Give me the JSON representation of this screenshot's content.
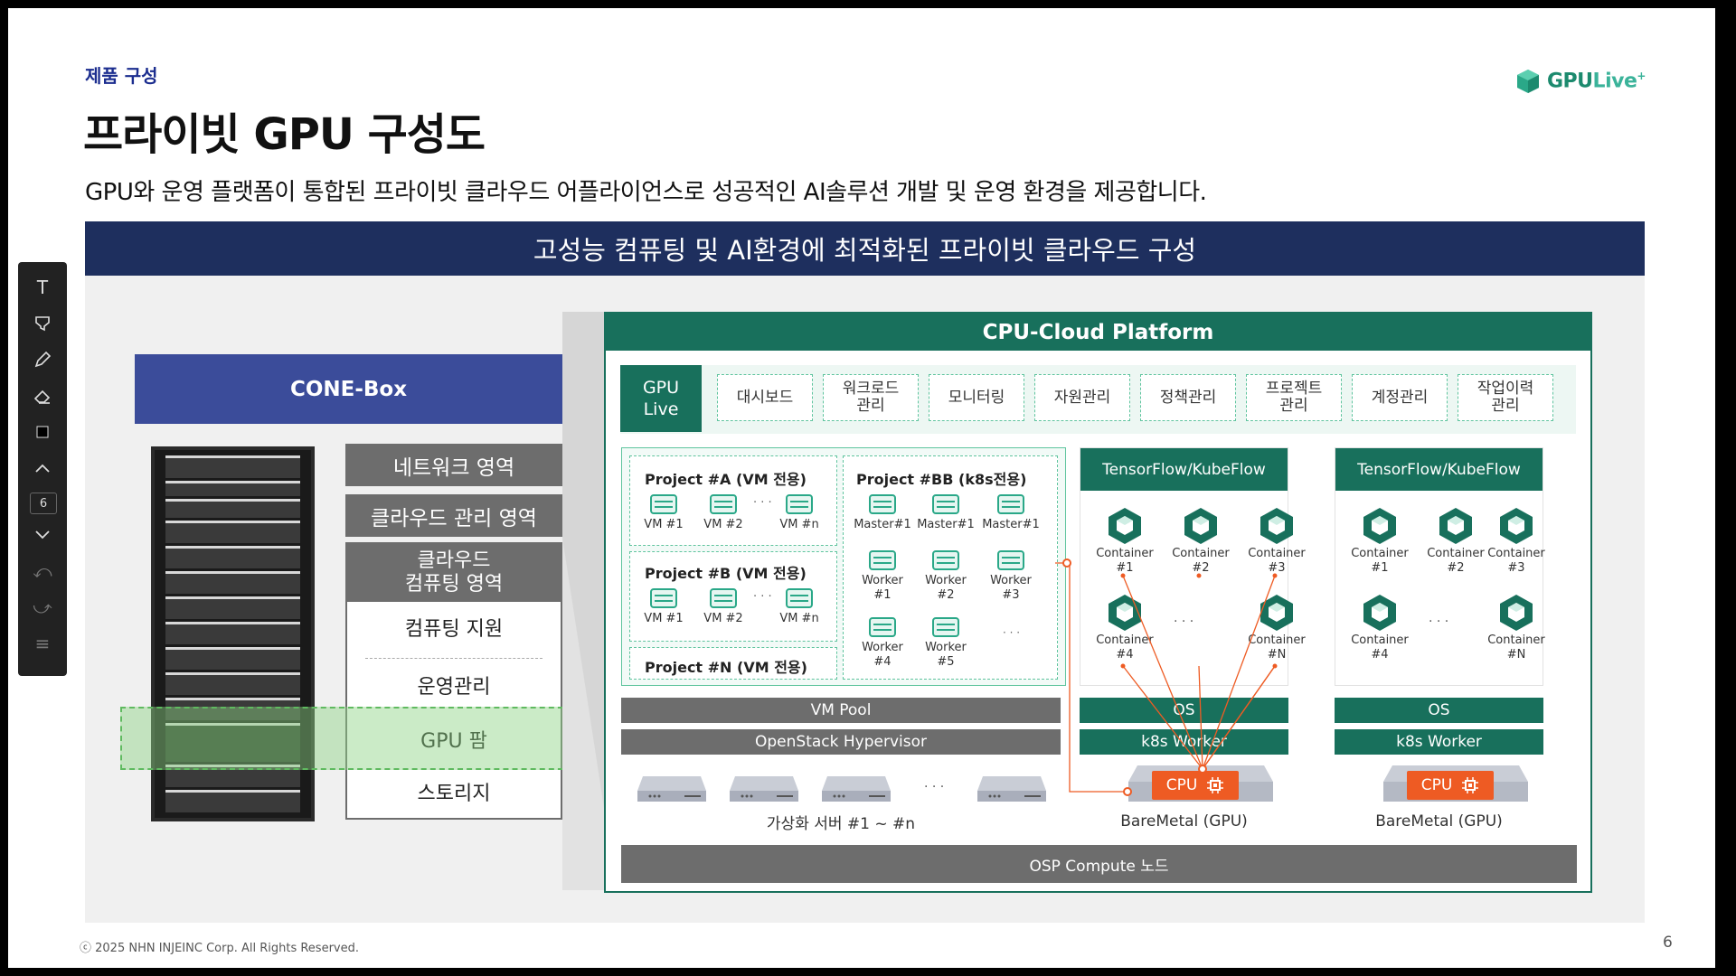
{
  "slide": {
    "kicker": "제품 구성",
    "title": "프라이빗 GPU 구성도",
    "subtitle": "GPU와 운영 플랫폼이 통합된 프라이빗 클라우드 어플라이언스로 성공적인 AI솔루션 개발 및 운영 환경을 제공합니다.",
    "logo_main": "GPU",
    "logo_accent": "Live",
    "logo_plus": "+",
    "banner": "고성능 컴퓨팅 및 AI환경에 최적화된 프라이빗 클라우드 구성",
    "footer": "ⓒ 2025 NHN INJEINC Corp. All Rights Reserved.",
    "page_number": "6"
  },
  "cone": {
    "title": "CONE-Box",
    "areas": [
      "네트워크 영역",
      "클라우드 관리 영역"
    ],
    "computing_head": "클라우드\n컴퓨팅 영역",
    "computing_items": [
      "컴퓨팅 지원",
      "운영관리",
      "GPU 팜",
      "스토리지"
    ]
  },
  "platform": {
    "title": "CPU-Cloud Platform",
    "gpu_live": "GPU\nLive",
    "menu": [
      "대시보드",
      "워크로드\n관리",
      "모니터링",
      "자원관리",
      "정책관리",
      "프로젝트\n관리",
      "계정관리",
      "작업이력\n관리"
    ],
    "projA": {
      "title": "Project #A (VM 전용)",
      "vms": [
        "VM #1",
        "VM #2",
        "VM #n"
      ]
    },
    "projB": {
      "title": "Project #B (VM 전용)",
      "vms": [
        "VM #1",
        "VM #2",
        "VM #n"
      ]
    },
    "projN": {
      "title": "Project #N (VM 전용)"
    },
    "projBB": {
      "title": "Project #BB (k8s전용)",
      "masters": [
        "Master#1",
        "Master#1",
        "Master#1"
      ],
      "workers_row1": [
        "Worker\n#1",
        "Worker\n#2",
        "Worker\n#3"
      ],
      "workers_row2": [
        "Worker\n#4",
        "Worker\n#5"
      ]
    },
    "ellipsis": "· · ·",
    "vm_pool": "VM Pool",
    "hypervisor": "OpenStack Hypervisor",
    "virt_caption": "가상화 서버 #1 ~ #n",
    "tf_title": "TensorFlow/KubeFlow",
    "containers_top": [
      "Container\n#1",
      "Container\n#2",
      "Container\n#3"
    ],
    "containers_bottom": [
      "Container\n#4",
      "Container\n#N"
    ],
    "os": "OS",
    "k8s_worker": "k8s Worker",
    "cpu": "CPU",
    "baremetal": "BareMetal (GPU)",
    "osp": "OSP Compute 노드"
  },
  "toolbar": {
    "icons": [
      "text-tool-icon",
      "highlighter-icon",
      "pen-icon",
      "eraser-icon",
      "stop-icon",
      "chevron-up-icon",
      "chevron-down-icon",
      "undo-icon",
      "redo-icon",
      "menu-icon"
    ],
    "page": "6"
  },
  "colors": {
    "navy": "#1e2f5e",
    "cone_blue": "#3b4c9a",
    "teal": "#18705c",
    "grey_bar": "#6d6d6d",
    "cpu_orange": "#ee5b23",
    "dashed_green": "#5fc49e"
  }
}
